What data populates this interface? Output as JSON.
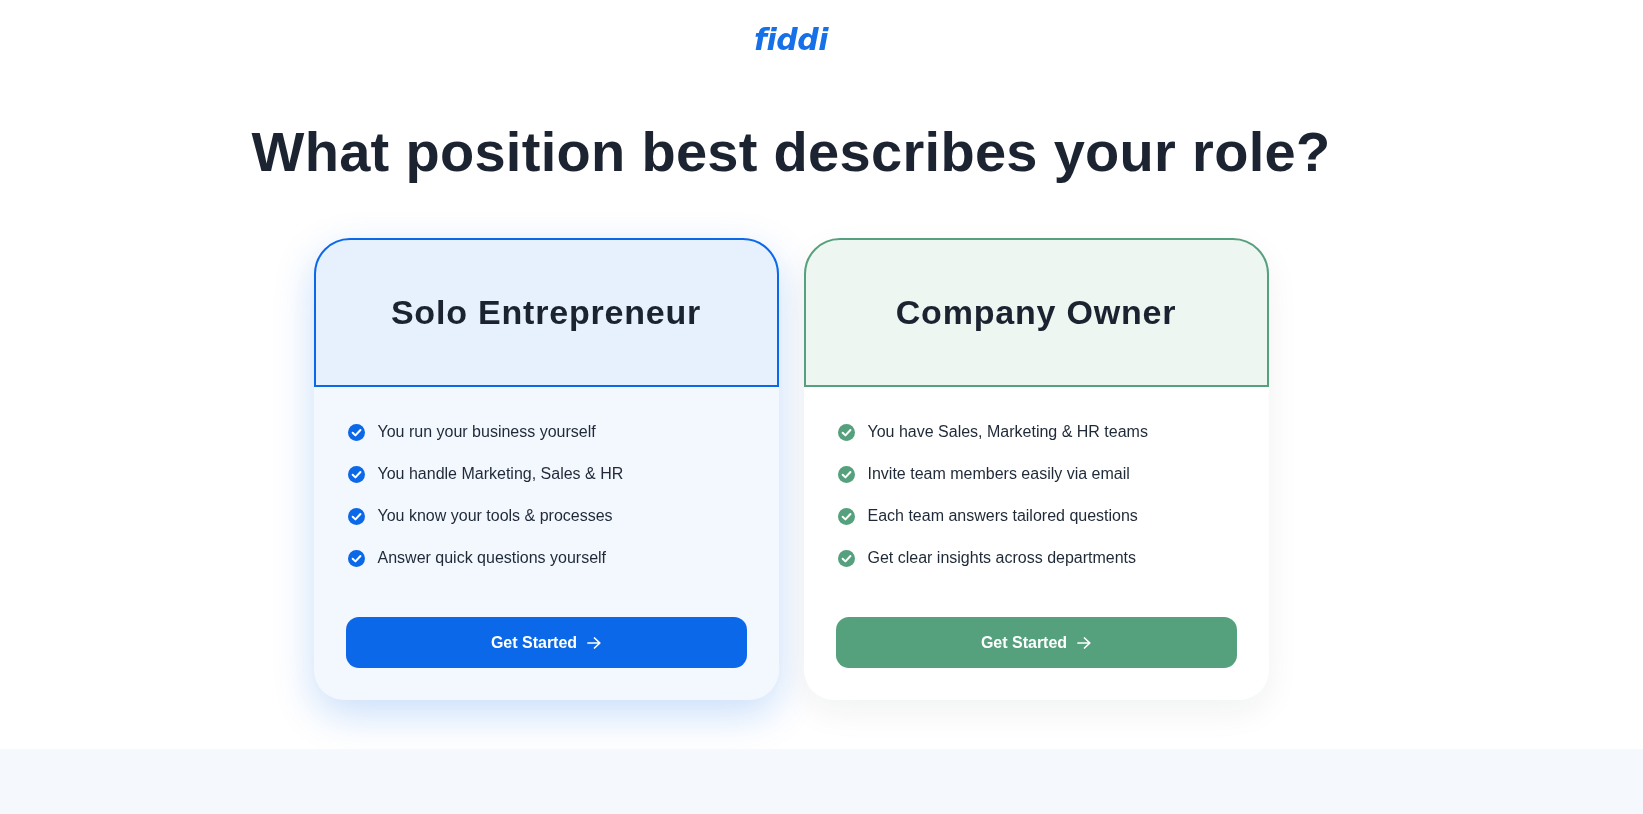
{
  "logo": {
    "text": "fiddi"
  },
  "heading": "What position best describes your role?",
  "cards": [
    {
      "title": "Solo Entrepreneur",
      "color": "#0b68e8",
      "selected": true,
      "features": [
        "You run your business yourself",
        "You handle Marketing, Sales & HR",
        "You know your tools & processes",
        "Answer quick questions yourself"
      ],
      "button": {
        "label": "Get Started"
      }
    },
    {
      "title": "Company Owner",
      "color": "#55a07d",
      "selected": false,
      "features": [
        "You have Sales, Marketing & HR teams",
        "Invite team members easily via email",
        "Each team answers tailored questions",
        "Get clear insights across departments"
      ],
      "button": {
        "label": "Get Started"
      }
    }
  ]
}
